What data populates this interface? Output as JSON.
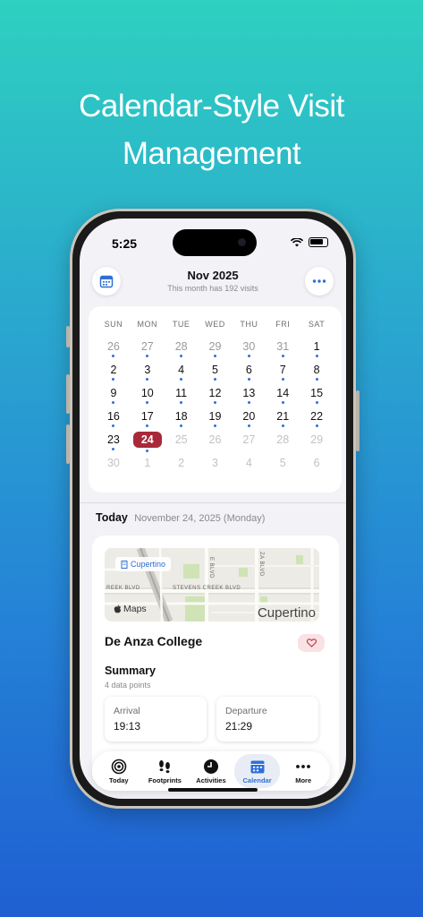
{
  "headline": {
    "line1": "Calendar-Style Visit",
    "line2": "Management"
  },
  "status_bar": {
    "time": "5:25"
  },
  "header": {
    "month": "Nov 2025",
    "subtitle": "This month has 192 visits"
  },
  "calendar": {
    "weekdays": [
      "SUN",
      "MON",
      "TUE",
      "WED",
      "THU",
      "FRI",
      "SAT"
    ],
    "weeks": [
      [
        {
          "d": "26",
          "s": "dim",
          "dot": true
        },
        {
          "d": "27",
          "s": "dim",
          "dot": true
        },
        {
          "d": "28",
          "s": "dim",
          "dot": true
        },
        {
          "d": "29",
          "s": "dim",
          "dot": true
        },
        {
          "d": "30",
          "s": "dim",
          "dot": true
        },
        {
          "d": "31",
          "s": "dim",
          "dot": true
        },
        {
          "d": "1",
          "s": "cur",
          "dot": true
        }
      ],
      [
        {
          "d": "2",
          "s": "cur",
          "dot": true
        },
        {
          "d": "3",
          "s": "cur",
          "dot": true
        },
        {
          "d": "4",
          "s": "cur",
          "dot": true
        },
        {
          "d": "5",
          "s": "cur",
          "dot": true
        },
        {
          "d": "6",
          "s": "cur",
          "dot": true
        },
        {
          "d": "7",
          "s": "cur",
          "dot": true
        },
        {
          "d": "8",
          "s": "cur",
          "dot": true
        }
      ],
      [
        {
          "d": "9",
          "s": "cur",
          "dot": true
        },
        {
          "d": "10",
          "s": "cur",
          "dot": true
        },
        {
          "d": "11",
          "s": "cur",
          "dot": true
        },
        {
          "d": "12",
          "s": "cur",
          "dot": true
        },
        {
          "d": "13",
          "s": "cur",
          "dot": true
        },
        {
          "d": "14",
          "s": "cur",
          "dot": true
        },
        {
          "d": "15",
          "s": "cur",
          "dot": true
        }
      ],
      [
        {
          "d": "16",
          "s": "cur",
          "dot": true
        },
        {
          "d": "17",
          "s": "cur",
          "dot": true
        },
        {
          "d": "18",
          "s": "cur",
          "dot": true
        },
        {
          "d": "19",
          "s": "cur",
          "dot": true
        },
        {
          "d": "20",
          "s": "cur",
          "dot": true
        },
        {
          "d": "21",
          "s": "cur",
          "dot": true
        },
        {
          "d": "22",
          "s": "cur",
          "dot": true
        }
      ],
      [
        {
          "d": "23",
          "s": "cur",
          "dot": true
        },
        {
          "d": "24",
          "s": "sel",
          "dot": true
        },
        {
          "d": "25",
          "s": "out",
          "dot": false
        },
        {
          "d": "26",
          "s": "out",
          "dot": false
        },
        {
          "d": "27",
          "s": "out",
          "dot": false
        },
        {
          "d": "28",
          "s": "out",
          "dot": false
        },
        {
          "d": "29",
          "s": "out",
          "dot": false
        }
      ],
      [
        {
          "d": "30",
          "s": "out",
          "dot": false
        },
        {
          "d": "1",
          "s": "out",
          "dot": false
        },
        {
          "d": "2",
          "s": "out",
          "dot": false
        },
        {
          "d": "3",
          "s": "out",
          "dot": false
        },
        {
          "d": "4",
          "s": "out",
          "dot": false
        },
        {
          "d": "5",
          "s": "out",
          "dot": false
        },
        {
          "d": "6",
          "s": "out",
          "dot": false
        }
      ]
    ]
  },
  "today": {
    "label": "Today",
    "date": "November 24, 2025 (Monday)"
  },
  "visit": {
    "map": {
      "chip": "Cupertino",
      "maps_label": "Maps",
      "city": "Cupertino",
      "street1": "STEVENS CREEK BLVD",
      "street2": "REEK BLVD",
      "street3": "E BLVD",
      "street4": "ZA BLVD"
    },
    "place": "De Anza College",
    "summary_title": "Summary",
    "summary_sub": "4 data points",
    "arrival_label": "Arrival",
    "arrival_value": "19:13",
    "departure_label": "Departure",
    "departure_value": "21:29"
  },
  "tabs": [
    {
      "label": "Today",
      "icon": "target-icon"
    },
    {
      "label": "Footprints",
      "icon": "footprints-icon"
    },
    {
      "label": "Activities",
      "icon": "clock-icon"
    },
    {
      "label": "Calendar",
      "icon": "calendar-icon",
      "active": true
    },
    {
      "label": "More",
      "icon": "ellipsis-icon"
    }
  ],
  "colors": {
    "accent": "#2f6fd6",
    "selected_day": "#a8293a"
  }
}
